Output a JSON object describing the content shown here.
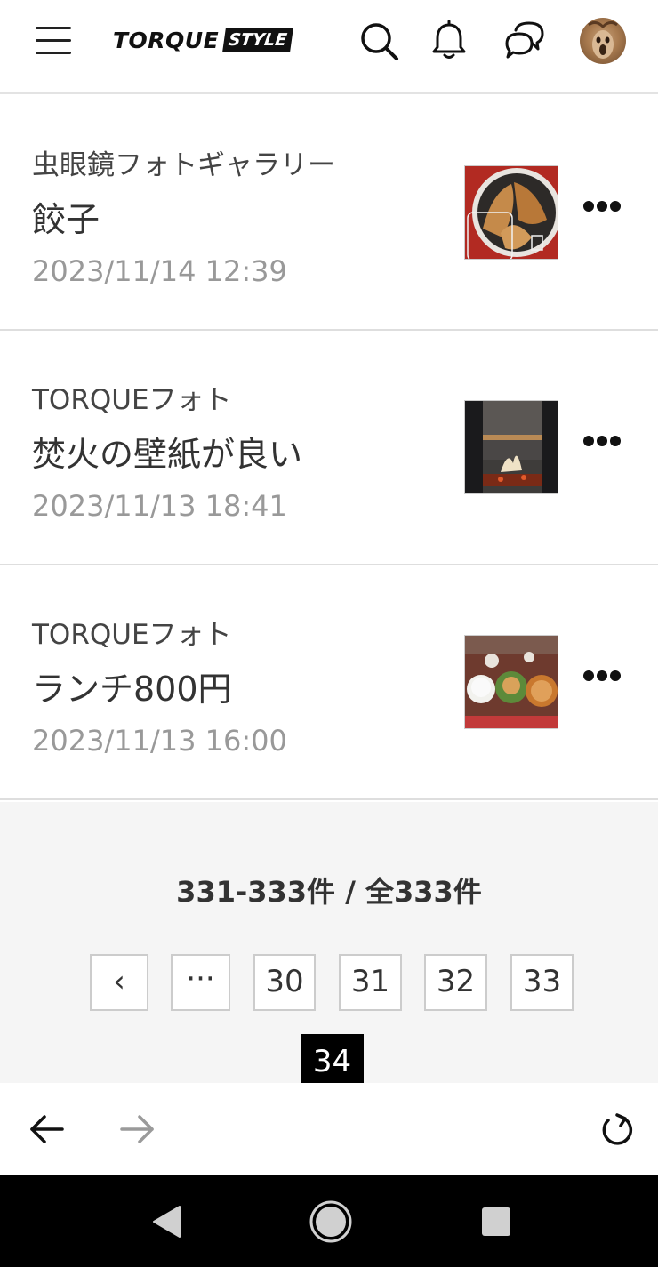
{
  "header": {
    "logo_main": "TORQUE",
    "logo_sub": "STYLE"
  },
  "icons": {
    "menu": "hamburger-menu-icon",
    "search": "search-icon",
    "notifications": "bell-icon",
    "messages": "chat-bubbles-icon",
    "more": "more-horizontal-icon",
    "back": "arrow-left-icon",
    "forward": "arrow-right-icon",
    "reload": "reload-icon"
  },
  "items": [
    {
      "category": "虫眼鏡フォトギャラリー",
      "title": "餃子",
      "date": "2023/11/14 12:39"
    },
    {
      "category": "TORQUEフォト",
      "title": "焚火の壁紙が良い",
      "date": "2023/11/13 18:41"
    },
    {
      "category": "TORQUEフォト",
      "title": "ランチ800円",
      "date": "2023/11/13 16:00"
    }
  ],
  "pagination": {
    "count_text": "331-333件 / 全333件",
    "prev_label": "‹",
    "ellipsis_label": "···",
    "pages": [
      "30",
      "31",
      "32",
      "33",
      "34"
    ],
    "current_page": "34"
  },
  "colors": {
    "accent_active_page": "#000000",
    "date_text": "#999999",
    "pager_background": "#f5f5f5"
  }
}
